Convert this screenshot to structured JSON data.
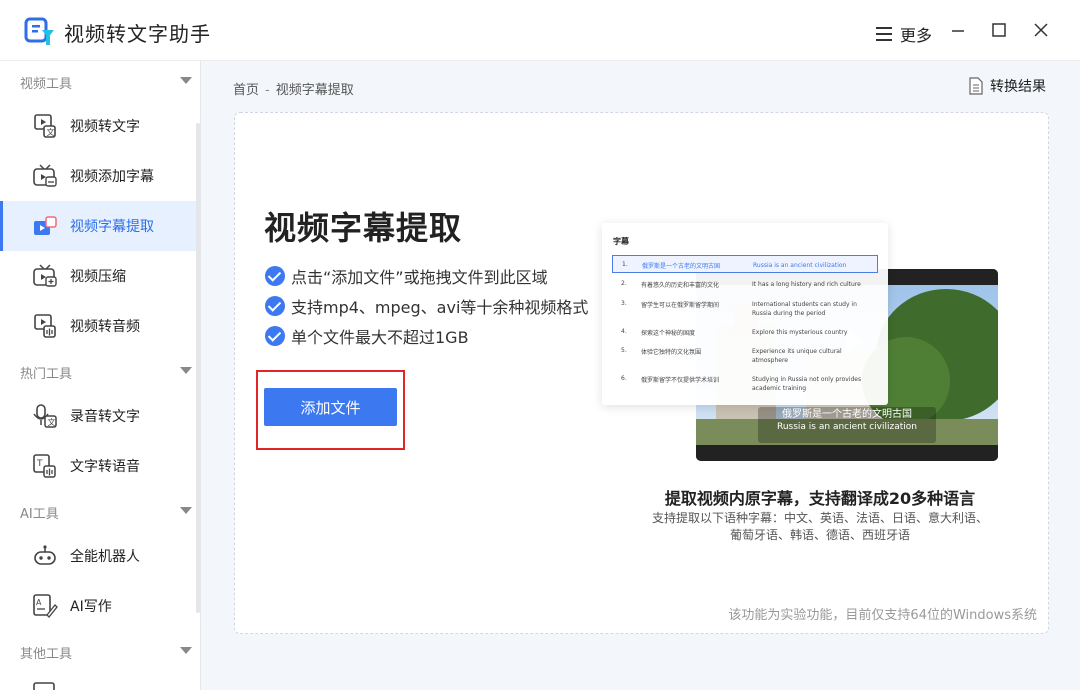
{
  "app": {
    "title": "视频转文字助手",
    "more_label": "更多"
  },
  "sidebar": {
    "groups": [
      {
        "header": "视频工具",
        "items": [
          "视频转文字",
          "视频添加字幕",
          "视频字幕提取",
          "视频压缩",
          "视频转音频"
        ]
      },
      {
        "header": "热门工具",
        "items": [
          "录音转文字",
          "文字转语音"
        ]
      },
      {
        "header": "AI工具",
        "items": [
          "全能机器人",
          "AI写作"
        ]
      },
      {
        "header": "其他工具",
        "items": []
      }
    ],
    "active_item": "视频字幕提取"
  },
  "breadcrumb": {
    "home": "首页",
    "sep": "-",
    "current": "视频字幕提取"
  },
  "result_link": "转换结果",
  "panel": {
    "title": "视频字幕提取",
    "features": [
      "点击“添加文件”或拖拽文件到此区域",
      "支持mp4、mpeg、avi等十余种视频格式",
      "单个文件最大不超过1GB"
    ],
    "add_button": "添加文件",
    "preview": {
      "card_title": "字幕",
      "rows": [
        {
          "n": "1.",
          "zh": "俄罗斯是一个古老的文明古国",
          "en": "Russia is an ancient civilization"
        },
        {
          "n": "2.",
          "zh": "有着悠久的历史和丰富的文化",
          "en": "It has a long history and rich culture"
        },
        {
          "n": "3.",
          "zh": "留学生可以在俄罗斯留学期间",
          "en": "International students can study in Russia during the period"
        },
        {
          "n": "4.",
          "zh": "探索这个神秘的国度",
          "en": "Explore this mysterious country"
        },
        {
          "n": "5.",
          "zh": "体验它独特的文化氛围",
          "en": "Experience its unique cultural atmosphere"
        },
        {
          "n": "6.",
          "zh": "俄罗斯留学不仅提供学术培训",
          "en": "Studying in Russia not only provides academic training"
        }
      ],
      "caption_zh": "俄罗斯是一个古老的文明古国",
      "caption_en": "Russia is an ancient civilization"
    },
    "sub_title": "提取视频内原字幕，支持翻译成20多种语言",
    "sub_desc_1": "支持提取以下语种字幕：中文、英语、法语、日语、意大利语、",
    "sub_desc_2": "葡萄牙语、韩语、德语、西班牙语",
    "footnote": "该功能为实验功能，目前仅支持64位的Windows系统"
  },
  "colors": {
    "accent": "#3c78f0",
    "highlight": "#e1262a",
    "main_bg": "#f3f6fb"
  }
}
